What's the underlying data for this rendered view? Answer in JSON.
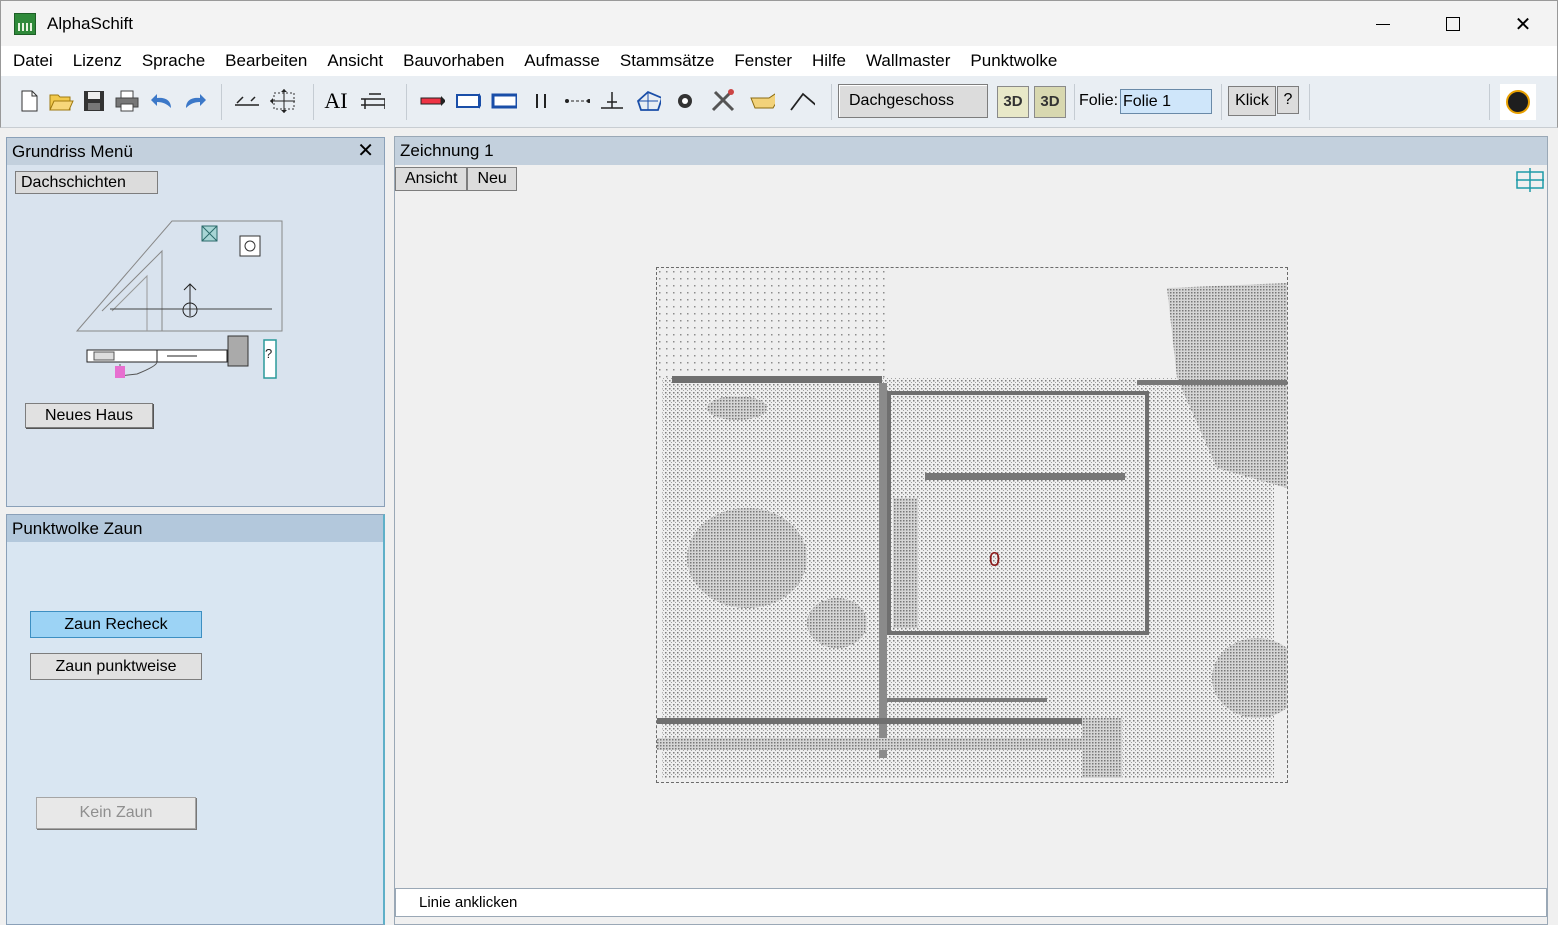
{
  "window": {
    "title": "AlphaSchift"
  },
  "menu": [
    "Datei",
    "Lizenz",
    "Sprache",
    "Bearbeiten",
    "Ansicht",
    "Bauvorhaben",
    "Aufmasse",
    "Stammsätze",
    "Fenster",
    "Hilfe",
    "Wallmaster",
    "Punktwolke"
  ],
  "toolbar": {
    "floor": "Dachgeschoss",
    "btn_3d_a": "3D",
    "btn_3d_b": "3D",
    "folie_label": "Folie:",
    "folie_value": "Folie 1",
    "klick": "Klick",
    "help": "?"
  },
  "grundriss_panel": {
    "title": "Grundriss Menü",
    "tab": "Dachschichten",
    "new_house": "Neues Haus",
    "diagram_help_mark": "?"
  },
  "zaun_panel": {
    "title": "Punktwolke Zaun",
    "zaun_recheck": "Zaun Recheck",
    "zaun_punktweise": "Zaun punktweise",
    "kein_zaun": "Kein Zaun"
  },
  "drawing": {
    "title": "Zeichnung 1",
    "tabs": [
      "Ansicht",
      "Neu"
    ],
    "marker": "0",
    "status": "Linie anklicken"
  },
  "colors": {
    "accent_blue": "#9cd3f5",
    "panel_bg": "#d9e6f2",
    "marker_red": "#8b1a1a"
  }
}
